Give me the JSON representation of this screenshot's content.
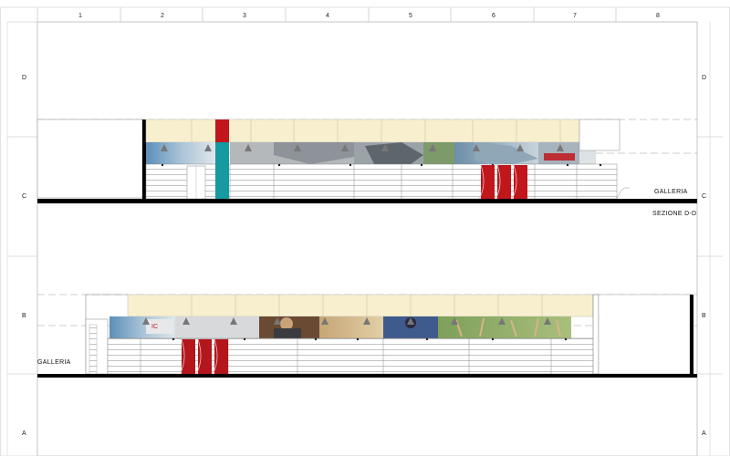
{
  "sheet": {
    "column_labels": [
      "1",
      "2",
      "3",
      "4",
      "5",
      "6",
      "7",
      "8"
    ],
    "row_labels": [
      "D",
      "C",
      "B",
      "A"
    ]
  },
  "upper_elevation": {
    "label_right": "GALLERIA",
    "panels": [
      "sky",
      "sky",
      "gray",
      "gray",
      "photo-bikes",
      "photo-bikes",
      "green",
      "photo-bikes",
      "sky",
      "sky",
      "red-logo"
    ],
    "accent_colors": {
      "red": "#c0161c",
      "teal": "#149aa0"
    }
  },
  "section_title": "SEZIONE D-D",
  "lower_elevation": {
    "label_left": "GALLERIA",
    "panels": [
      "sky",
      "sky",
      "photo-cyclist",
      "photo-cyclist",
      "tan",
      "tan",
      "photo-cyclist",
      "photo-cyclist",
      "green-field",
      "green-field"
    ],
    "accent_colors": {
      "red": "#b3161b"
    }
  }
}
